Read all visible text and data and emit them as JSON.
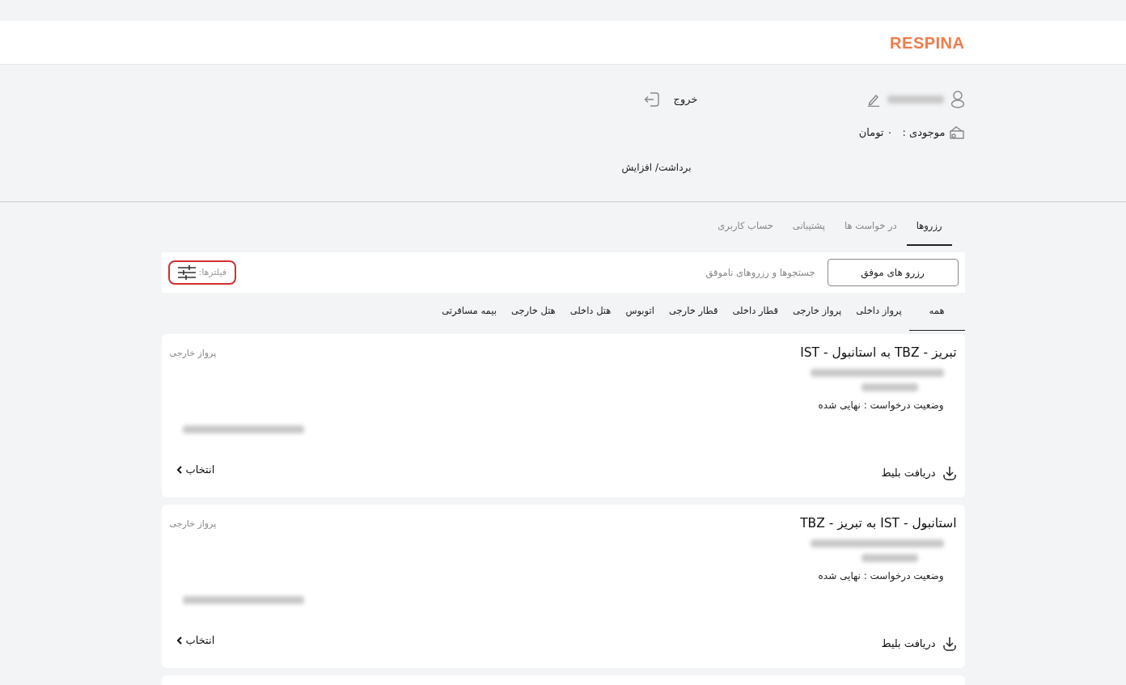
{
  "header": {
    "logo": "RESPINA"
  },
  "profile": {
    "logout": "خروج",
    "balance_label": "موجودی :",
    "balance_value": "۰ تومان",
    "wallet_action": "برداشت/ افزایش"
  },
  "tabs": [
    {
      "label": "رزروها",
      "selected": true
    },
    {
      "label": "در خواست ها",
      "selected": false
    },
    {
      "label": "پشتیبانی",
      "selected": false
    },
    {
      "label": "حساب کاربری",
      "selected": false
    }
  ],
  "filter_bar": {
    "buttons": [
      {
        "label": "رزرو های موفق",
        "selected": true
      },
      {
        "label": "جستجوها و رزروهای ناموفق",
        "selected": false
      }
    ],
    "filters_label": "فیلترها:"
  },
  "categories": [
    {
      "label": "همه",
      "selected": true
    },
    {
      "label": "پرواز داخلی",
      "selected": false
    },
    {
      "label": "پرواز خارجی",
      "selected": false
    },
    {
      "label": "قطار داخلی",
      "selected": false
    },
    {
      "label": "قطار خارجی",
      "selected": false
    },
    {
      "label": "اتوبوس",
      "selected": false
    },
    {
      "label": "هتل داخلی",
      "selected": false
    },
    {
      "label": "هتل خارجی",
      "selected": false
    },
    {
      "label": "بیمه مسافرتی",
      "selected": false
    }
  ],
  "bookings": [
    {
      "title": "تبریز - TBZ به استانبول - IST",
      "type": "پرواز خارجی",
      "status": "وضعیت درخواست : نهایی شده",
      "download": "دریافت بلیط",
      "select": "انتخاب"
    },
    {
      "title": "استانبول - IST به تبریز - TBZ",
      "type": "پرواز خارجی",
      "status": "وضعیت درخواست : نهایی شده",
      "download": "دریافت بلیط",
      "select": "انتخاب"
    }
  ]
}
